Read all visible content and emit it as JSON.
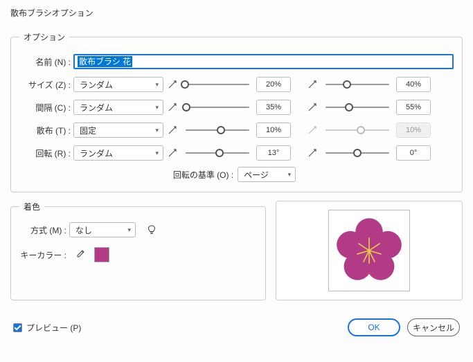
{
  "dialog": {
    "title": "散布ブラシオプション"
  },
  "options": {
    "legend": "オプション",
    "name_label": "名前 (N) :",
    "name_value": "散布ブラシ 花",
    "rows": {
      "size": {
        "label": "サイズ (Z) :",
        "mode": "ランダム",
        "val1": "20%",
        "pos1": 3,
        "val2": "40%",
        "pos2": 35,
        "enabled2": true
      },
      "spacing": {
        "label": "間隔 (C) :",
        "mode": "ランダム",
        "val1": "35%",
        "pos1": 5,
        "val2": "55%",
        "pos2": 38,
        "enabled2": true
      },
      "scatter": {
        "label": "散布 (T) :",
        "mode": "固定",
        "val1": "10%",
        "pos1": 55,
        "val2": "10%",
        "pos2": 55,
        "enabled2": false
      },
      "rotation": {
        "label": "回転 (R) :",
        "mode": "ランダム",
        "val1": "13°",
        "pos1": 53,
        "val2": "0°",
        "pos2": 50,
        "enabled2": true
      }
    },
    "axis_label": "回転の基準 (O) :",
    "axis_value": "ページ"
  },
  "color": {
    "legend": "着色",
    "method_label": "方式 (M) :",
    "method_value": "なし",
    "key_label": "キーカラー :",
    "swatch_hex": "#b33a86"
  },
  "preview_flower": {
    "fill": "#b33a86",
    "spoke": "#e6c84a"
  },
  "footer": {
    "preview_label": "プレビュー (P)",
    "ok": "OK",
    "cancel": "キャンセル"
  }
}
